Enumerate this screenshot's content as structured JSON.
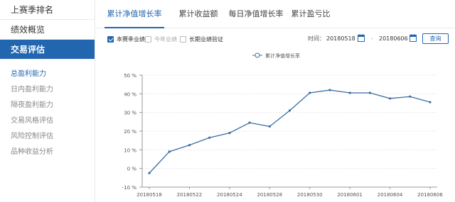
{
  "sidebar": {
    "main_items": [
      {
        "label": "上赛季排名",
        "active": false
      },
      {
        "label": "绩效概览",
        "active": false
      },
      {
        "label": "交易评估",
        "active": true
      }
    ],
    "sub_items": [
      {
        "label": "总盈利能力",
        "active": true
      },
      {
        "label": "日内盈利能力",
        "active": false
      },
      {
        "label": "隔夜盈利能力",
        "active": false
      },
      {
        "label": "交易风格评估",
        "active": false
      },
      {
        "label": "风险控制评估",
        "active": false
      },
      {
        "label": "品种收益分析",
        "active": false
      }
    ]
  },
  "tabs": [
    {
      "label": "累计净值增长率",
      "active": true
    },
    {
      "label": "累计收益额",
      "active": false
    },
    {
      "label": "每日净值增长率",
      "active": false
    },
    {
      "label": "累计盈亏比",
      "active": false
    }
  ],
  "filters": {
    "season": {
      "label": "本赛季业绩",
      "checked": true
    },
    "year": {
      "label": "今年业绩",
      "checked": false
    },
    "long": {
      "label": "长期业绩验证",
      "checked": false
    }
  },
  "date_filter": {
    "label": "时间：",
    "start": "20180518",
    "separator": "-",
    "end": "20180606",
    "query_label": "查询"
  },
  "colors": {
    "accent": "#2266b0",
    "series": "#3a6ea5"
  },
  "chart_data": {
    "type": "line",
    "legend": "累计净值增长率",
    "legend_position": "top-center",
    "grid": true,
    "ylim": [
      -10,
      50
    ],
    "yticks": [
      -10,
      0,
      10,
      20,
      30,
      40,
      50
    ],
    "ytick_labels": [
      "-10 %",
      "0 %",
      "10 %",
      "20 %",
      "30 %",
      "40 %",
      "50 %"
    ],
    "x_labels": [
      "20180518",
      "20180522",
      "20180524",
      "20180528",
      "20180530",
      "20180601",
      "20180604",
      "20180606"
    ],
    "x_label_indices": [
      0,
      2,
      4,
      6,
      8,
      10,
      12,
      14
    ],
    "series": [
      {
        "name": "累计净值增长率",
        "values": [
          -2.5,
          9,
          12.5,
          16.5,
          19,
          24.5,
          22.5,
          31,
          40.5,
          42,
          40.5,
          40.5,
          37.5,
          38.5,
          35.5
        ]
      }
    ]
  }
}
